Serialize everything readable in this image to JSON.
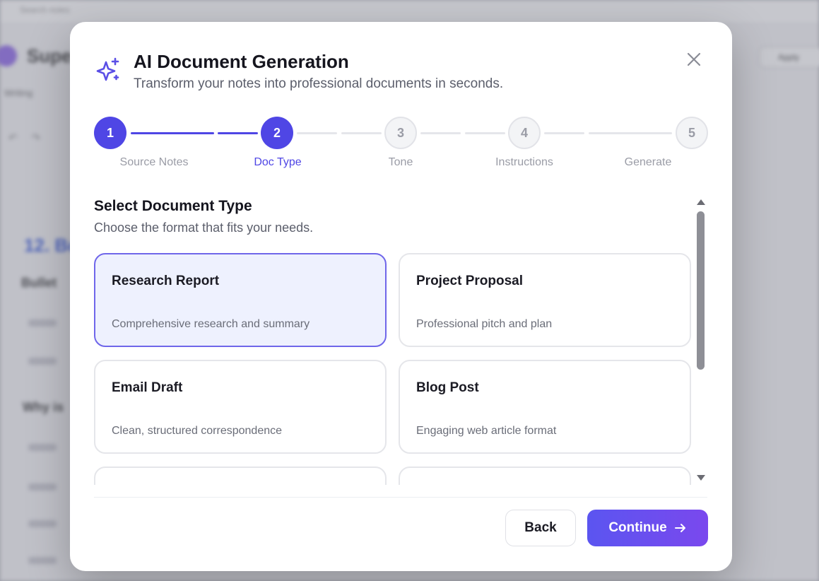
{
  "background": {
    "search_placeholder": "Search notes",
    "doc_title": "Supe",
    "tab": "Writing",
    "heading": "12. Bo",
    "sub1": "Bullet",
    "sub2": "Why is",
    "right_button": "Apply"
  },
  "modal": {
    "title": "AI Document Generation",
    "subtitle": "Transform your notes into professional documents in seconds.",
    "close_icon": "close-icon",
    "header_icon": "sparkles-icon"
  },
  "stepper": {
    "current_step": 2,
    "steps": [
      {
        "number": "1",
        "label": "Source Notes",
        "state": "done"
      },
      {
        "number": "2",
        "label": "Doc Type",
        "state": "active"
      },
      {
        "number": "3",
        "label": "Tone",
        "state": "todo"
      },
      {
        "number": "4",
        "label": "Instructions",
        "state": "todo"
      },
      {
        "number": "5",
        "label": "Generate",
        "state": "todo"
      }
    ],
    "colors": {
      "accent": "#4f46e5",
      "inactive": "#9a9ca6"
    }
  },
  "section": {
    "title": "Select Document Type",
    "subtitle": "Choose the format that fits your needs."
  },
  "cards": [
    {
      "title": "Research Report",
      "desc": "Comprehensive research and summary",
      "selected": true
    },
    {
      "title": "Project Proposal",
      "desc": "Professional pitch and plan",
      "selected": false
    },
    {
      "title": "Email Draft",
      "desc": "Clean, structured correspondence",
      "selected": false
    },
    {
      "title": "Blog Post",
      "desc": "Engaging web article format",
      "selected": false
    },
    {
      "title": "",
      "desc": "",
      "selected": false
    },
    {
      "title": "",
      "desc": "",
      "selected": false
    }
  ],
  "footer": {
    "back_label": "Back",
    "continue_label": "Continue",
    "continue_icon": "arrow-right-icon"
  }
}
